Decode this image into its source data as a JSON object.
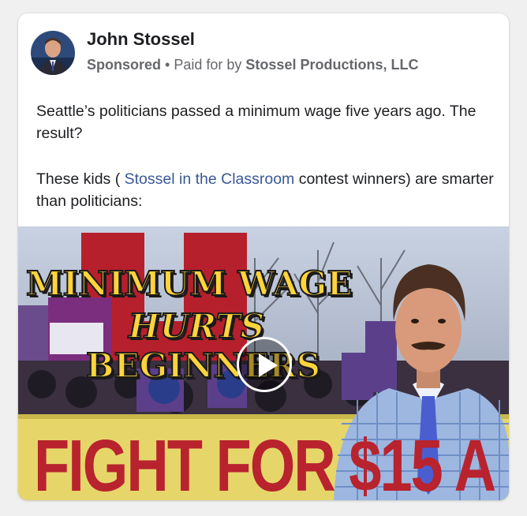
{
  "post": {
    "author": "John Stossel",
    "sponsored": "Sponsored",
    "separator": "•",
    "paid_for_by": "Paid for by",
    "sponsor": "Stossel Productions, LLC",
    "paragraph1": "Seattle’s politicians passed a minimum wage five years ago. The result?",
    "paragraph2_before": "These kids ( ",
    "paragraph2_link": "Stossel in the Classroom",
    "paragraph2_after": " contest winners) are smarter than politicians:"
  },
  "video": {
    "headline_line1": "MINIMUM WAGE",
    "headline_line2": "HURTS",
    "headline_line3": "BEGINNERS",
    "banner": "FIGHT FOR $15 A"
  },
  "colors": {
    "link": "#385898",
    "headline_yellow": "#ffd43b",
    "banner_red": "#b8232e"
  }
}
